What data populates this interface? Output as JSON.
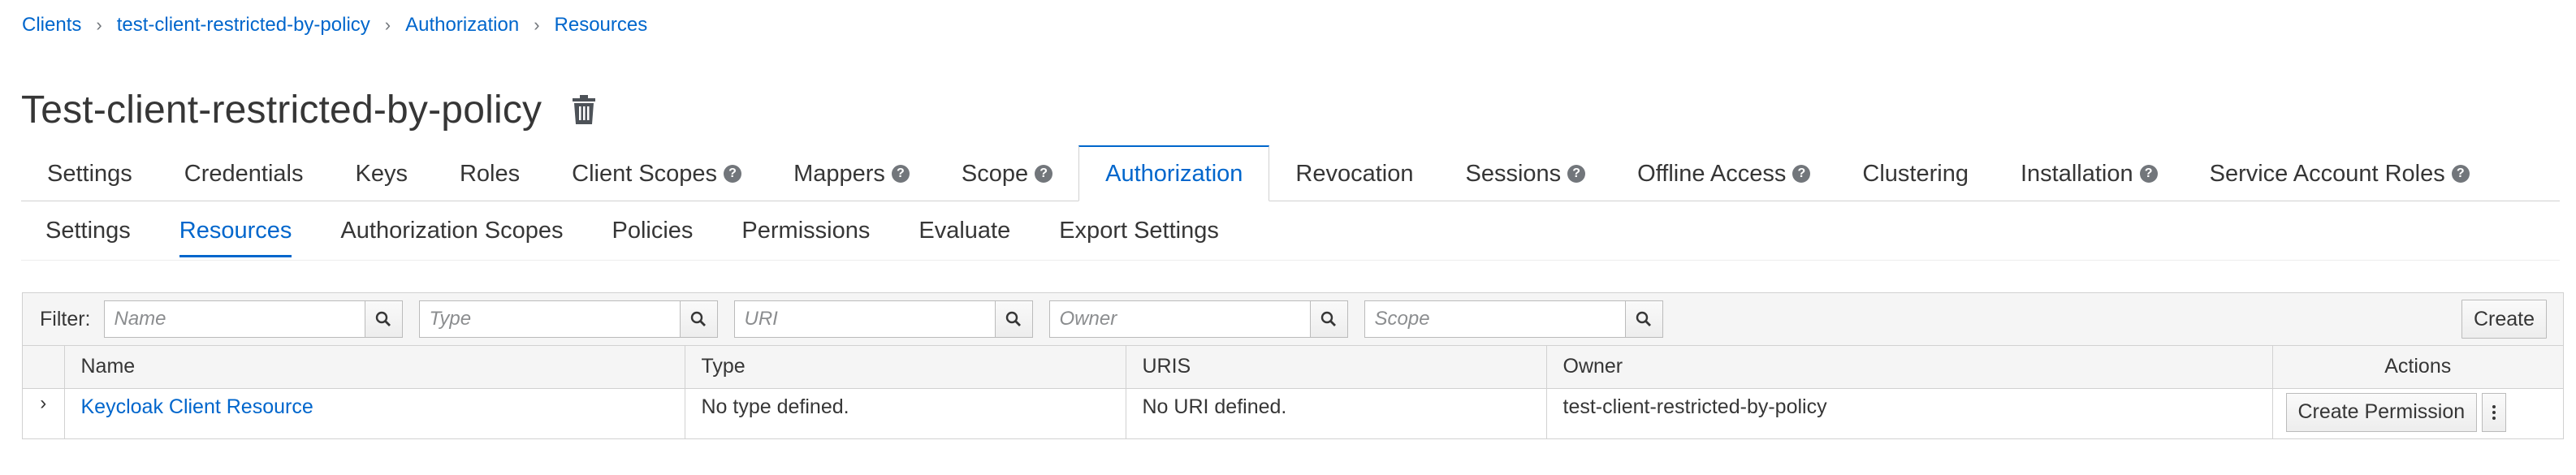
{
  "breadcrumb": [
    "Clients",
    "test-client-restricted-by-policy",
    "Authorization",
    "Resources"
  ],
  "page": {
    "title": "Test-client-restricted-by-policy"
  },
  "tabs": [
    {
      "label": "Settings",
      "help": false
    },
    {
      "label": "Credentials",
      "help": false
    },
    {
      "label": "Keys",
      "help": false
    },
    {
      "label": "Roles",
      "help": false
    },
    {
      "label": "Client Scopes",
      "help": true
    },
    {
      "label": "Mappers",
      "help": true
    },
    {
      "label": "Scope",
      "help": true
    },
    {
      "label": "Authorization",
      "help": false,
      "active": true
    },
    {
      "label": "Revocation",
      "help": false
    },
    {
      "label": "Sessions",
      "help": true
    },
    {
      "label": "Offline Access",
      "help": true
    },
    {
      "label": "Clustering",
      "help": false
    },
    {
      "label": "Installation",
      "help": true
    },
    {
      "label": "Service Account Roles",
      "help": true
    }
  ],
  "subtabs": [
    {
      "label": "Settings"
    },
    {
      "label": "Resources",
      "active": true
    },
    {
      "label": "Authorization Scopes"
    },
    {
      "label": "Policies"
    },
    {
      "label": "Permissions"
    },
    {
      "label": "Evaluate"
    },
    {
      "label": "Export Settings"
    }
  ],
  "toolbar": {
    "filter_label": "Filter:",
    "filters": [
      {
        "placeholder": "Name",
        "value": ""
      },
      {
        "placeholder": "Type",
        "value": ""
      },
      {
        "placeholder": "URI",
        "value": ""
      },
      {
        "placeholder": "Owner",
        "value": ""
      },
      {
        "placeholder": "Scope",
        "value": ""
      }
    ],
    "create_label": "Create"
  },
  "table": {
    "columns": [
      "Name",
      "Type",
      "URIS",
      "Owner",
      "Actions"
    ],
    "rows": [
      {
        "name": "Keycloak Client Resource",
        "type": "No type defined.",
        "uris": "No URI defined.",
        "owner": "test-client-restricted-by-policy",
        "action_label": "Create Permission"
      }
    ]
  },
  "icons": {
    "help": "?",
    "expand": "›"
  },
  "colors": {
    "link": "#0066cc",
    "text": "#363636",
    "border": "#d1d1d1",
    "toolbar_bg": "#f5f5f5"
  }
}
